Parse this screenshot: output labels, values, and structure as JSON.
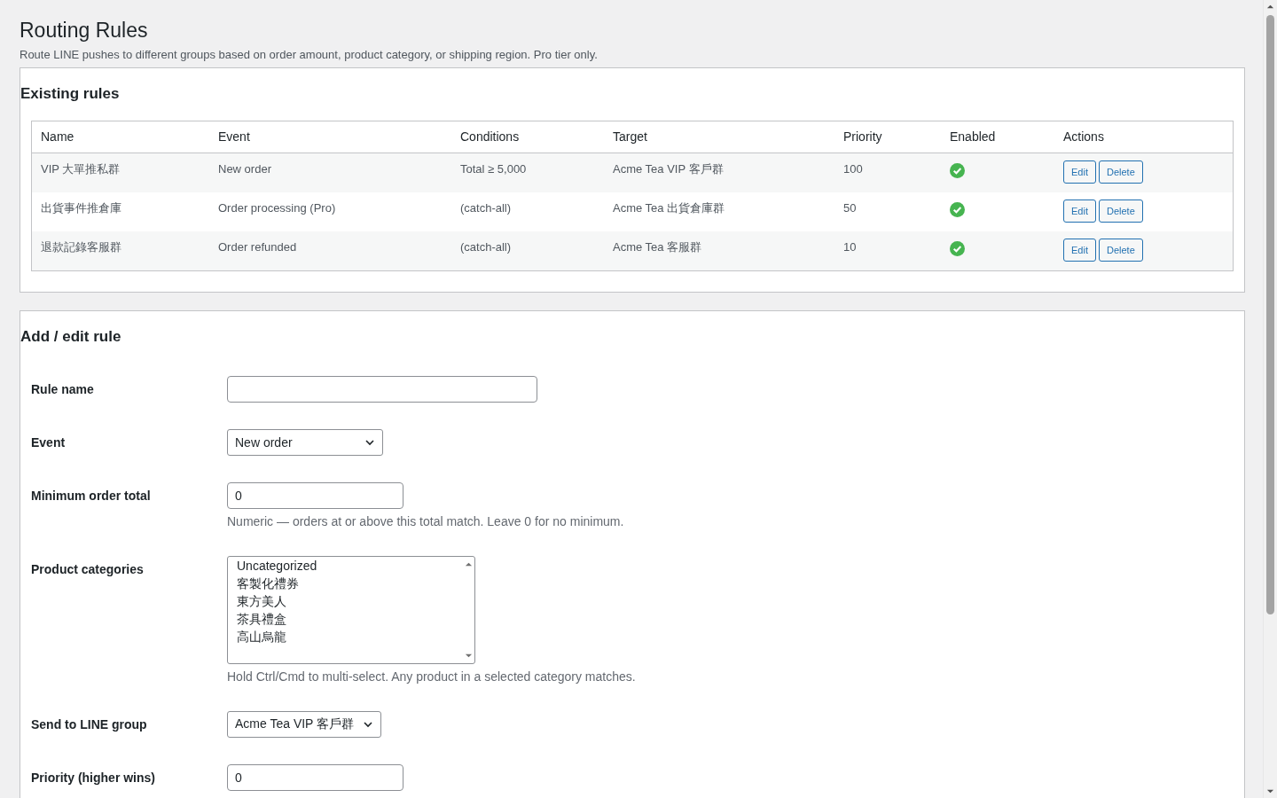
{
  "page": {
    "title": "Routing Rules",
    "description": "Route LINE pushes to different groups based on order amount, product category, or shipping region. Pro tier only."
  },
  "existing_rules": {
    "heading": "Existing rules",
    "columns": [
      "Name",
      "Event",
      "Conditions",
      "Target",
      "Priority",
      "Enabled",
      "Actions"
    ],
    "rows": [
      {
        "name": "VIP 大單推私群",
        "event": "New order",
        "conditions": "Total ≥ 5,000",
        "target": "Acme Tea VIP 客戶群",
        "priority": "100",
        "enabled": true,
        "actions": [
          "Edit",
          "Delete"
        ]
      },
      {
        "name": "出貨事件推倉庫",
        "event": "Order processing (Pro)",
        "conditions": "(catch-all)",
        "target": "Acme Tea 出貨倉庫群",
        "priority": "50",
        "enabled": true,
        "actions": [
          "Edit",
          "Delete"
        ]
      },
      {
        "name": "退款記錄客服群",
        "event": "Order refunded",
        "conditions": "(catch-all)",
        "target": "Acme Tea 客服群",
        "priority": "10",
        "enabled": true,
        "actions": [
          "Edit",
          "Delete"
        ]
      }
    ]
  },
  "rule_form": {
    "heading": "Add / edit rule",
    "fields": [
      {
        "kind": "text",
        "label": "Rule name"
      },
      {
        "kind": "select",
        "label": "Event",
        "value": "New order"
      },
      {
        "kind": "number",
        "label": "Minimum order total",
        "value": "0",
        "help": "Numeric — orders at or above this total match. Leave 0 for no minimum."
      },
      {
        "kind": "listbox",
        "label": "Product categories",
        "options": [
          {
            "label": "Uncategorized",
            "selected": false
          },
          {
            "label": "客製化禮券",
            "selected": false
          },
          {
            "label": "東方美人",
            "selected": false
          },
          {
            "label": "茶具禮盒",
            "selected": false
          },
          {
            "label": "高山烏龍",
            "selected": false
          }
        ],
        "help": "Hold Ctrl/Cmd to multi-select. Any product in a selected category matches."
      },
      {
        "kind": "select",
        "label": "Send to LINE group",
        "value": "Acme Tea VIP 客戶群"
      },
      {
        "kind": "number",
        "label": "Priority (higher wins)",
        "value": "0"
      }
    ]
  }
}
